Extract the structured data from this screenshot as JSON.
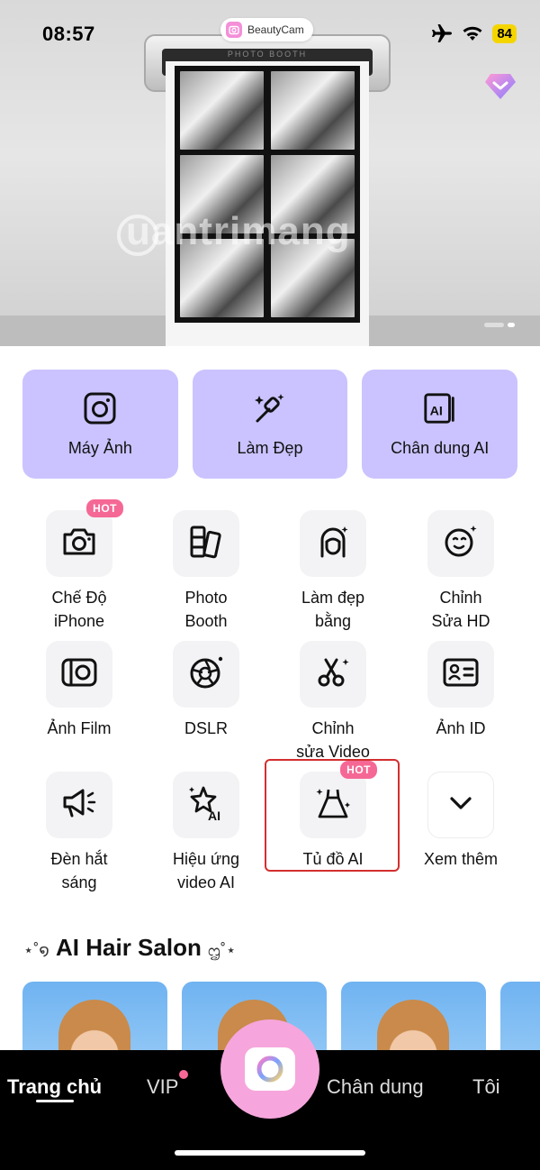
{
  "status": {
    "time": "08:57",
    "battery": "84"
  },
  "hero": {
    "brand": "BeautyCam",
    "booth_label": "PHOTO BOOTH",
    "watermark": "uantrimang"
  },
  "main_cards": [
    {
      "label": "Máy Ảnh",
      "icon": "camera-square-icon"
    },
    {
      "label": "Làm Đẹp",
      "icon": "makeup-brush-icon"
    },
    {
      "label": "Chân dung AI",
      "icon": "ai-portrait-icon"
    }
  ],
  "tools": [
    {
      "label": "Chế Độ\niPhone",
      "icon": "camera-icon",
      "badge": "HOT"
    },
    {
      "label": "Photo\nBooth",
      "icon": "photo-booth-icon"
    },
    {
      "label": "Làm đẹp\nbằng",
      "icon": "face-beauty-icon"
    },
    {
      "label": "Chỉnh\nSửa HD",
      "icon": "smile-sparkle-icon"
    },
    {
      "label": "Ảnh Film",
      "icon": "film-camera-icon"
    },
    {
      "label": "DSLR",
      "icon": "aperture-icon"
    },
    {
      "label": "Chỉnh\nsửa Video",
      "icon": "scissors-icon"
    },
    {
      "label": "Ảnh ID",
      "icon": "id-card-icon"
    },
    {
      "label": "Đèn hắt\nsáng",
      "icon": "spotlight-icon"
    },
    {
      "label": "Hiệu ứng\nvideo AI",
      "icon": "ai-sparkle-icon"
    },
    {
      "label": "Tủ đồ AI",
      "icon": "dress-icon",
      "badge": "HOT"
    },
    {
      "label": "Xem thêm",
      "icon": "chevron-down-icon"
    }
  ],
  "section": {
    "title": "AI Hair Salon",
    "deco_left": "⋆˚໑",
    "deco_right": "ᦗ˚⋆"
  },
  "nav": {
    "home": "Trang chủ",
    "vip": "VIP",
    "portrait": "Chân dung",
    "me": "Tôi"
  },
  "colors": {
    "card_bg": "#cac3ff",
    "hot_badge": "#f56896",
    "highlight": "#d32f2f",
    "camera_button": "#f6a6dc"
  }
}
